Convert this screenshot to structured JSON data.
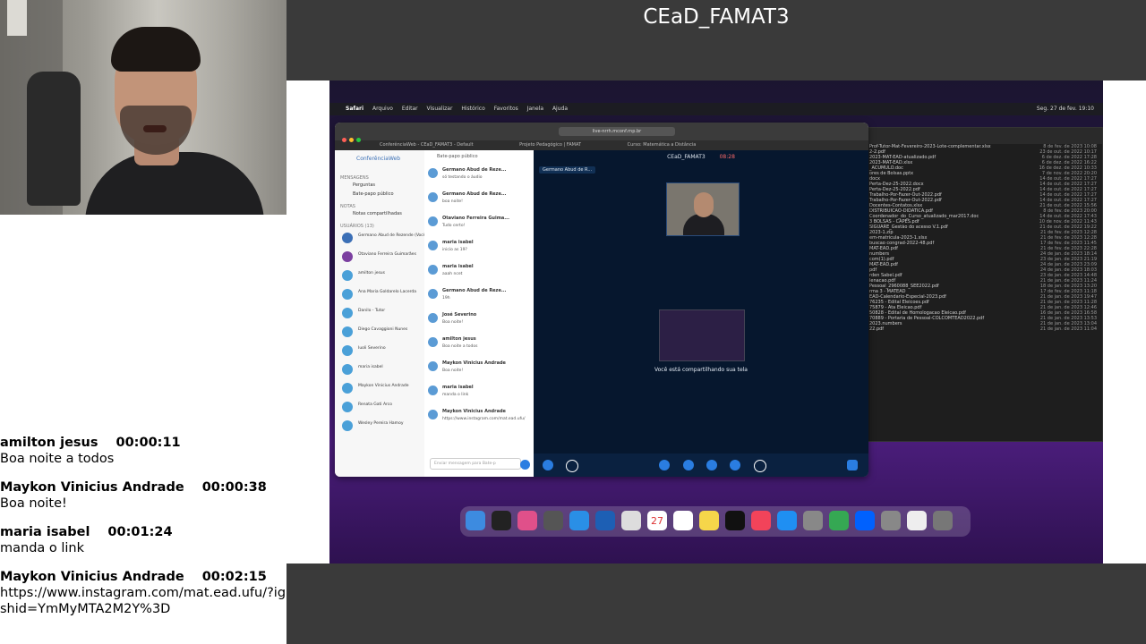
{
  "room": {
    "title": "CEaD_FAMAT3"
  },
  "chat": [
    {
      "name": "amilton jesus",
      "time": "00:00:11",
      "text": "Boa noite a todos"
    },
    {
      "name": "Maykon Vinicius Andrade",
      "time": "00:00:38",
      "text": "Boa noite!"
    },
    {
      "name": "maria isabel",
      "time": "00:01:24",
      "text": "manda o link"
    },
    {
      "name": "Maykon Vinicius Andrade",
      "time": "00:02:15",
      "text": "https://www.instagram.com/mat.ead.ufu/?igshid=YmMyMTA2M2Y%3D"
    }
  ],
  "shared_screen": {
    "menubar": {
      "items": [
        "Safari",
        "Arquivo",
        "Editar",
        "Visualizar",
        "Histórico",
        "Favoritos",
        "Janela",
        "Ajuda"
      ],
      "clock": "Seg. 27 de fev. 19:10"
    },
    "browser": {
      "url": "live-nrrh.mconf.rnp.br",
      "tabs": [
        "ConferênciaWeb - CEaD_FAMAT3 - Default",
        "Projeto Pedagógico | FAMAT",
        "Curso: Matemática a Distância"
      ]
    },
    "conference": {
      "logo": "ConferênciaWeb",
      "messages_heading": "MENSAGENS",
      "side_items": [
        "Perguntas",
        "Bate-papo público"
      ],
      "notes_heading": "NOTAS",
      "notes_item": "Notas compartilhadas",
      "users_heading": "USUÁRIOS (13)",
      "users": [
        "Germano Abud de Rezende (Você)",
        "Otaviano Ferreira Guimarães",
        "amilton jesus",
        "Ana Maria Goldarelo Lacerda",
        "Danilo - Tutor",
        "Diego Cavaggioni Nunes",
        "Iuoli Severino",
        "maria isabel",
        "Maykon Vinicius Andrade",
        "Renata Gati Arco",
        "Wesley Pereira Hamoy"
      ],
      "chat_header": "Bate-papo público",
      "chat_messages": [
        {
          "name": "Germano Abud de Reze...",
          "text": "só testando o áudio"
        },
        {
          "name": "Germano Abud de Reze...",
          "text": "boa noite!"
        },
        {
          "name": "Otaviano Ferreira Guima...",
          "text": "Tudo certo!"
        },
        {
          "name": "maria isabel",
          "text": "inicio as 19?"
        },
        {
          "name": "maria isabel",
          "text": "aaah ncet"
        },
        {
          "name": "Germano Abud de Reze...",
          "text": "19h"
        },
        {
          "name": "José Severino",
          "text": "Boa noite!"
        },
        {
          "name": "amilton jesus",
          "text": "Boa noite a todos"
        },
        {
          "name": "Maykon Vinicius Andrade",
          "text": "Boa noite!"
        },
        {
          "name": "maria isabel",
          "text": "manda o link"
        },
        {
          "name": "Maykon Vinicius Andrade",
          "text": "https://www.instagram.com/mat.ead.ufu/"
        }
      ],
      "chat_placeholder": "Enviar mensagem para Bate-p",
      "room_header": "CEaD_FAMAT3",
      "timer": "08:28",
      "presenter": "Germano Abud de R...",
      "share_caption": "Você está compartilhando sua tela"
    },
    "finder_files": [
      {
        "name": "Prof-Tutor-Mat-Fevereiro-2023-Lote-complementar.xlsx",
        "date": "8 de fev. de 2023 10:08"
      },
      {
        "name": "2-2.pdf",
        "date": "23 de out. de 2022 10:17"
      },
      {
        "name": "2023-MAT-EAD-atualizado.pdf",
        "date": "6 de dez. de 2022 17:28"
      },
      {
        "name": "2023-MAT-EAD.xlsx",
        "date": "6 de dez. de 2022 16:22"
      },
      {
        "name": "_ACUMULO.doc",
        "date": "16 de dez. de 2022 10:33"
      },
      {
        "name": "ores de Bolsas.pptx",
        "date": "7 de nov. de 2022 20:20"
      },
      {
        "name": "docx",
        "date": "14 de out. de 2022 17:27"
      },
      {
        "name": "Perta-Dez-25-2022.docx",
        "date": "14 de out. de 2022 17:27"
      },
      {
        "name": "Perta-Dez-25-2022.pdf",
        "date": "14 de out. de 2022 17:27"
      },
      {
        "name": "Trabalho-Por-Fazer-Out-2022.pdf",
        "date": "14 de out. de 2022 17:27"
      },
      {
        "name": "Trabalho-Por-Fazer-Out-2022.pdf",
        "date": "14 de out. de 2022 17:27"
      },
      {
        "name": "Docentes-Contatos.xlsx",
        "date": "21 de out. de 2022 15:56"
      },
      {
        "name": "DISTRIBUICAO-DIDATICA.pdf",
        "date": "8 de fev. de 2023 20:00"
      },
      {
        "name": "Coordenador_do_Curso_atualizado_mar2017.doc",
        "date": "14 de out. de 2022 17:43"
      },
      {
        "name": "3 BOLSAS - CAPES.pdf",
        "date": "10 de nov. de 2022 11:43"
      },
      {
        "name": "SIGUARE_Gestão do acesso V.1.pdf",
        "date": "21 de out. de 2022 19:22"
      },
      {
        "name": "2023-1.zip",
        "date": "21 de fev. de 2023 12:28"
      },
      {
        "name": "em-matricula-2023-1.xlsx",
        "date": "21 de fev. de 2023 12:28"
      },
      {
        "name": "buscao congrad-2022-48.pdf",
        "date": "17 de fev. de 2023 11:45"
      },
      {
        "name": "MAT-EAD.pdf",
        "date": "21 de fev. de 2023 22:28"
      },
      {
        "name": "numbers",
        "date": "24 de jan. de 2023 18:14"
      },
      {
        "name": "com(1).pdf",
        "date": "23 de jan. de 2023 21:19"
      },
      {
        "name": "MAT-EAD.pdf",
        "date": "24 de jan. de 2023 23:09"
      },
      {
        "name": "pdf",
        "date": "24 de jan. de 2023 18:03"
      },
      {
        "name": "rden Sabel.pdf",
        "date": "23 de jan. de 2023 14:48"
      },
      {
        "name": "lenacao.pdf",
        "date": "21 de jan. de 2023 11:24"
      },
      {
        "name": "Pessoal_2960088_SEE2022.pdf",
        "date": "18 de jan. de 2023 13:20"
      },
      {
        "name": "rma 3 - MATEAD",
        "date": "17 de fev. de 2023 11:18"
      },
      {
        "name": "EAD-Calendario-Especial-2023.pdf",
        "date": "21 de jan. de 2023 19:47"
      },
      {
        "name": "76235 - Edital Eleicoes.pdf",
        "date": "21 de jan. de 2023 11:28"
      },
      {
        "name": "75879 - Ata Eleicao.pdf",
        "date": "21 de jan. de 2023 12:46"
      },
      {
        "name": "50828 - Edital de Homologacao Eleicao.pdf",
        "date": "16 de jan. de 2023 16:58"
      },
      {
        "name": "70889 - Portaria de Pessoal-COLCOMTEAD2022.pdf",
        "date": "21 de jan. de 2023 13:53"
      },
      {
        "name": "2023.numbers",
        "date": "21 de jan. de 2023 13:04"
      },
      {
        "name": "22.pdf",
        "date": "21 de jan. de 2023 11:04"
      }
    ],
    "dock_icons": [
      "finder-icon",
      "terminal-icon",
      "launchpad-icon",
      "calculator-icon",
      "safari-icon",
      "outlook-icon",
      "tex-icon",
      "calendar-icon",
      "reminders-icon",
      "notes-icon",
      "tv-icon",
      "music-icon",
      "app-store-icon",
      "settings-icon",
      "drive-icon",
      "dropbox-icon",
      "preview-icon",
      "document-icon",
      "trash-icon"
    ],
    "calendar_day": "27"
  }
}
